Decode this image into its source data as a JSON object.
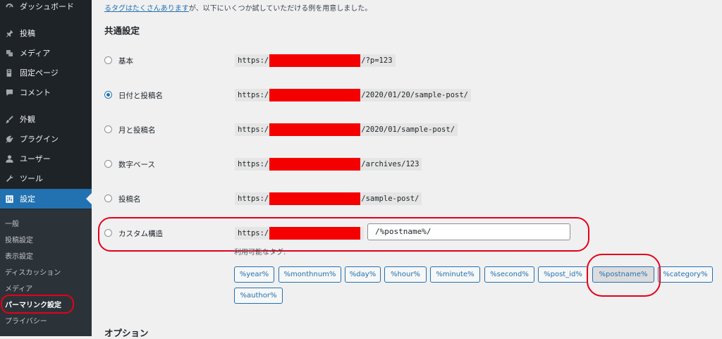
{
  "sidebar": {
    "items": [
      {
        "label": "ダッシュボード",
        "icon": "dashboard-icon"
      },
      {
        "label": "投稿",
        "icon": "pin-icon"
      },
      {
        "label": "メディア",
        "icon": "media-icon"
      },
      {
        "label": "固定ページ",
        "icon": "page-icon"
      },
      {
        "label": "コメント",
        "icon": "comment-icon"
      },
      {
        "label": "外観",
        "icon": "brush-icon"
      },
      {
        "label": "プラグイン",
        "icon": "plugin-icon"
      },
      {
        "label": "ユーザー",
        "icon": "user-icon"
      },
      {
        "label": "ツール",
        "icon": "wrench-icon"
      },
      {
        "label": "設定",
        "icon": "settings-icon"
      }
    ],
    "submenu": [
      "一般",
      "投稿設定",
      "表示設定",
      "ディスカッション",
      "メディア",
      "パーマリンク設定",
      "プライバシー"
    ]
  },
  "intro": {
    "link": "るタグはたくさんあります",
    "text": "が、以下にいくつか試していただける例を用意しました。"
  },
  "common_settings_title": "共通設定",
  "options": [
    {
      "label": "基本",
      "prefix": "https:/",
      "suffix": "/?p=123",
      "checked": false
    },
    {
      "label": "日付と投稿名",
      "prefix": "https:/",
      "suffix": "/2020/01/20/sample-post/",
      "checked": true
    },
    {
      "label": "月と投稿名",
      "prefix": "https:/",
      "suffix": "/2020/01/sample-post/",
      "checked": false
    },
    {
      "label": "数字ベース",
      "prefix": "https:/",
      "suffix": "/archives/123",
      "checked": false
    },
    {
      "label": "投稿名",
      "prefix": "https:/",
      "suffix": "/sample-post/",
      "checked": false
    },
    {
      "label": "カスタム構造",
      "prefix": "https:/",
      "value": "/%postname%/",
      "checked": false
    }
  ],
  "available_tags_label": "利用可能なタグ:",
  "tags": [
    "%year%",
    "%monthnum%",
    "%day%",
    "%hour%",
    "%minute%",
    "%second%",
    "%post_id%",
    "%postname%",
    "%category%",
    "%author%"
  ],
  "options_title": "オプション",
  "colors": {
    "accent": "#2271b1",
    "annotation": "#e3001b",
    "redaction": "#f40000"
  }
}
